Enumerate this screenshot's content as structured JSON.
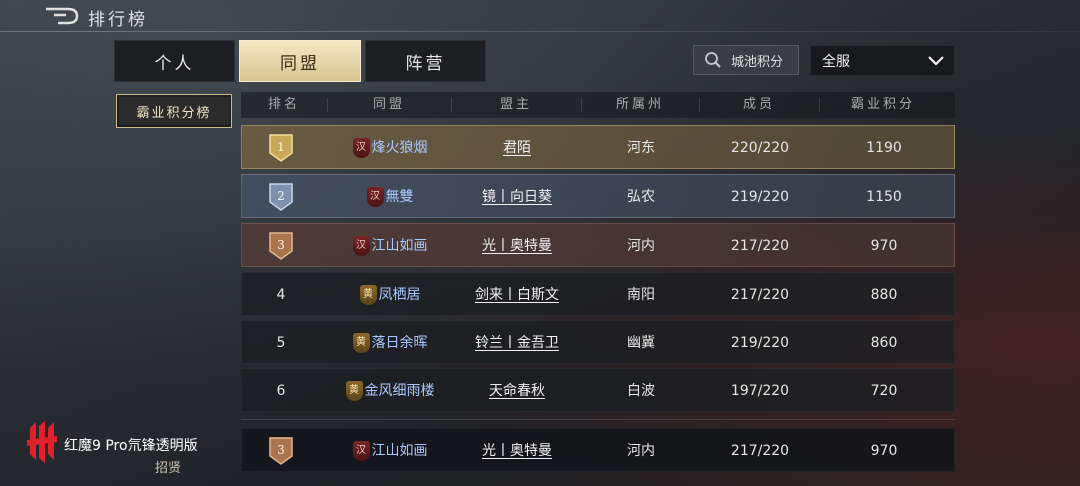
{
  "header": {
    "title": "排行榜"
  },
  "tabs": [
    {
      "label": "个人",
      "active": false
    },
    {
      "label": "同盟",
      "active": true
    },
    {
      "label": "阵营",
      "active": false
    }
  ],
  "search": {
    "label": "城池积分",
    "icon": "search-icon"
  },
  "server_select": {
    "value": "全服",
    "icon": "chevron-down-icon"
  },
  "side_category": {
    "label": "霸业积分榜"
  },
  "table": {
    "headers": [
      "排名",
      "同盟",
      "盟主",
      "所属州",
      "成员",
      "霸业积分"
    ],
    "rows": [
      {
        "rank": "1",
        "tier": "gold",
        "flag": "汉",
        "alliance": "烽火狼烟",
        "leader": "君陌",
        "state": "河东",
        "members": "220/220",
        "score": "1190"
      },
      {
        "rank": "2",
        "tier": "silver",
        "flag": "汉",
        "alliance": "無雙",
        "leader": "镜丨向日葵",
        "state": "弘农",
        "members": "219/220",
        "score": "1150"
      },
      {
        "rank": "3",
        "tier": "bronze",
        "flag": "汉",
        "alliance": "江山如画",
        "leader": "光丨奥特曼",
        "state": "河内",
        "members": "217/220",
        "score": "970"
      },
      {
        "rank": "4",
        "tier": "none",
        "flag": "黄",
        "alliance": "凤栖居",
        "leader": "剑来丨白斯文",
        "state": "南阳",
        "members": "217/220",
        "score": "880"
      },
      {
        "rank": "5",
        "tier": "none",
        "flag": "黄",
        "alliance": "落日余晖",
        "leader": "铃兰丨金吾卫",
        "state": "幽冀",
        "members": "219/220",
        "score": "860"
      },
      {
        "rank": "6",
        "tier": "none",
        "flag": "黄",
        "alliance": "金风细雨楼",
        "leader": "天命春秋",
        "state": "白波",
        "members": "197/220",
        "score": "720"
      }
    ],
    "my_row": {
      "rank": "3",
      "tier": "bronze",
      "flag": "汉",
      "alliance": "江山如画",
      "leader": "光丨奥特曼",
      "state": "河内",
      "members": "217/220",
      "score": "970"
    }
  },
  "watermark": {
    "text": "红魔9 Pro氘锋透明版",
    "sub": "招贤"
  },
  "colors": {
    "gold": "#d8c590",
    "alliance_text": "#a9c8ff",
    "han_flag": "#7a2424",
    "huang_flag": "#8a6a2a"
  }
}
